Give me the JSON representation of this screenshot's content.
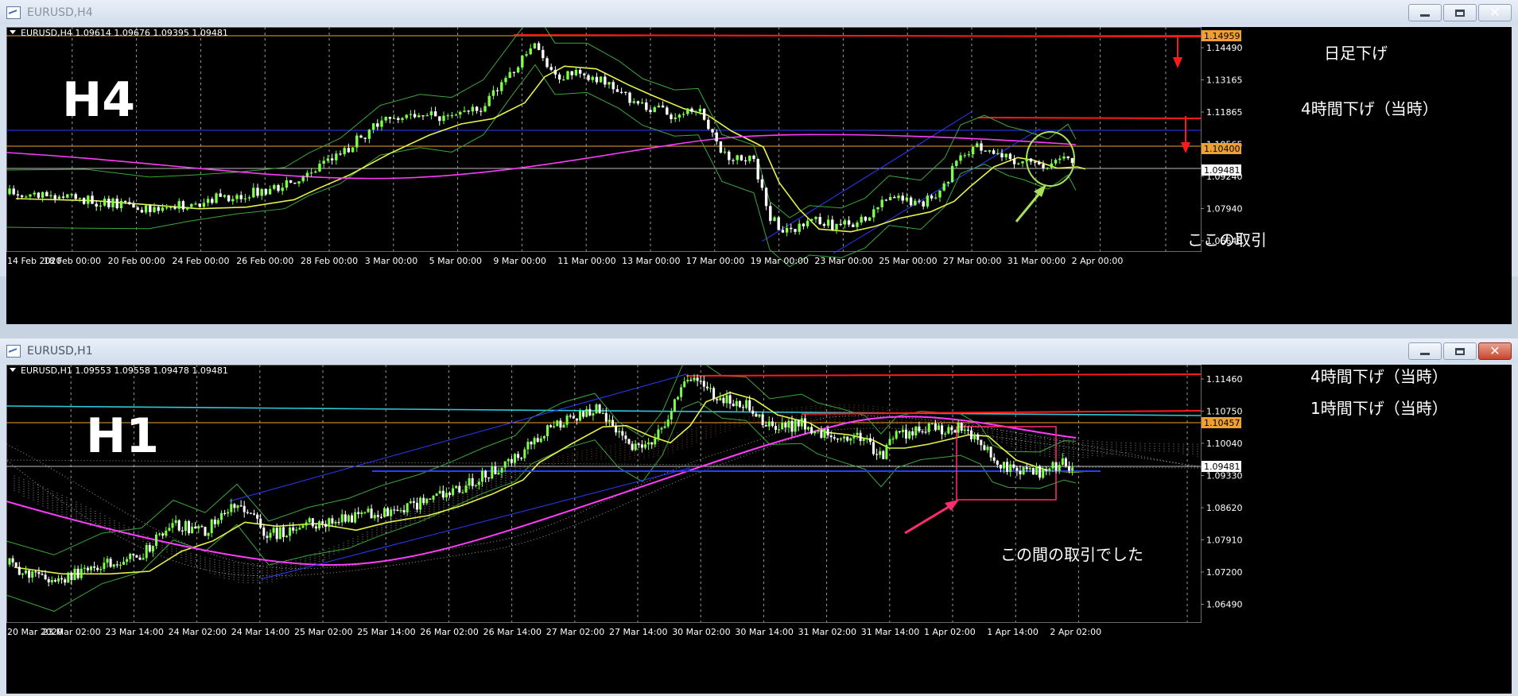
{
  "windows": [
    {
      "title": "EURUSD,H4",
      "info_line": "EURUSD,H4  1.09614 1.09676 1.09395 1.09481",
      "label": "H4",
      "price_axis": [
        "1.14490",
        "1.13165",
        "1.11865",
        "1.10565",
        "1.09240",
        "1.07940",
        "1.06640"
      ],
      "price_tags": [
        {
          "value": "1.14959",
          "color": "#f0a030"
        },
        {
          "value": "1.10400",
          "color": "#f0a030"
        },
        {
          "value": "1.09481",
          "color": "#ffffff"
        }
      ],
      "time_axis": [
        "14 Feb 2020",
        "18 Feb 00:00",
        "20 Feb 00:00",
        "24 Feb 00:00",
        "26 Feb 00:00",
        "28 Feb 00:00",
        "3 Mar 00:00",
        "5 Mar 00:00",
        "9 Mar 00:00",
        "11 Mar 00:00",
        "13 Mar 00:00",
        "17 Mar 00:00",
        "19 Mar 00:00",
        "23 Mar 00:00",
        "25 Mar 00:00",
        "27 Mar 00:00",
        "31 Mar 00:00",
        "2 Apr 00:00"
      ],
      "annotations": [
        "日足下げ",
        "4時間下げ（当時）",
        "ここの取引"
      ]
    },
    {
      "title": "EURUSD,H1",
      "info_line": "EURUSD,H1  1.09553 1.09558 1.09478 1.09481",
      "label": "H1",
      "price_axis": [
        "1.11460",
        "1.10750",
        "1.10040",
        "1.09330",
        "1.08620",
        "1.07910",
        "1.07200",
        "1.06490"
      ],
      "price_tags": [
        {
          "value": "1.10457",
          "color": "#f0a030"
        },
        {
          "value": "1.09481",
          "color": "#ffffff"
        }
      ],
      "time_axis": [
        "20 Mar 2020",
        "23 Mar 02:00",
        "23 Mar 14:00",
        "24 Mar 02:00",
        "24 Mar 14:00",
        "25 Mar 02:00",
        "25 Mar 14:00",
        "26 Mar 02:00",
        "26 Mar 14:00",
        "27 Mar 02:00",
        "27 Mar 14:00",
        "30 Mar 02:00",
        "30 Mar 14:00",
        "31 Mar 02:00",
        "31 Mar 14:00",
        "1 Apr 02:00",
        "1 Apr 14:00",
        "2 Apr 02:00"
      ],
      "annotations": [
        "4時間下げ（当時）",
        "1時間下げ（当時）",
        "この間の取引でした"
      ]
    }
  ],
  "colors": {
    "background": "#000000",
    "bull_candle": "#7dff4a",
    "bear_candle": "#ffffff",
    "ma_fast": "#e6f24a",
    "ma_slow": "#ff3cff",
    "bollinger": "#3aa83a",
    "resistance": "#ff1a1a",
    "trend_channel": "#2a3cff",
    "price_line_orange": "#f0a030",
    "arrow_green": "#a8e05a",
    "arrow_pink": "#ff2d6f",
    "cloud": "#ffffff",
    "cloud_alt": "#e0884a"
  },
  "icons": [
    "chart-window-icon",
    "minimize-icon",
    "maximize-icon",
    "close-icon",
    "dropdown-triangle-icon"
  ]
}
